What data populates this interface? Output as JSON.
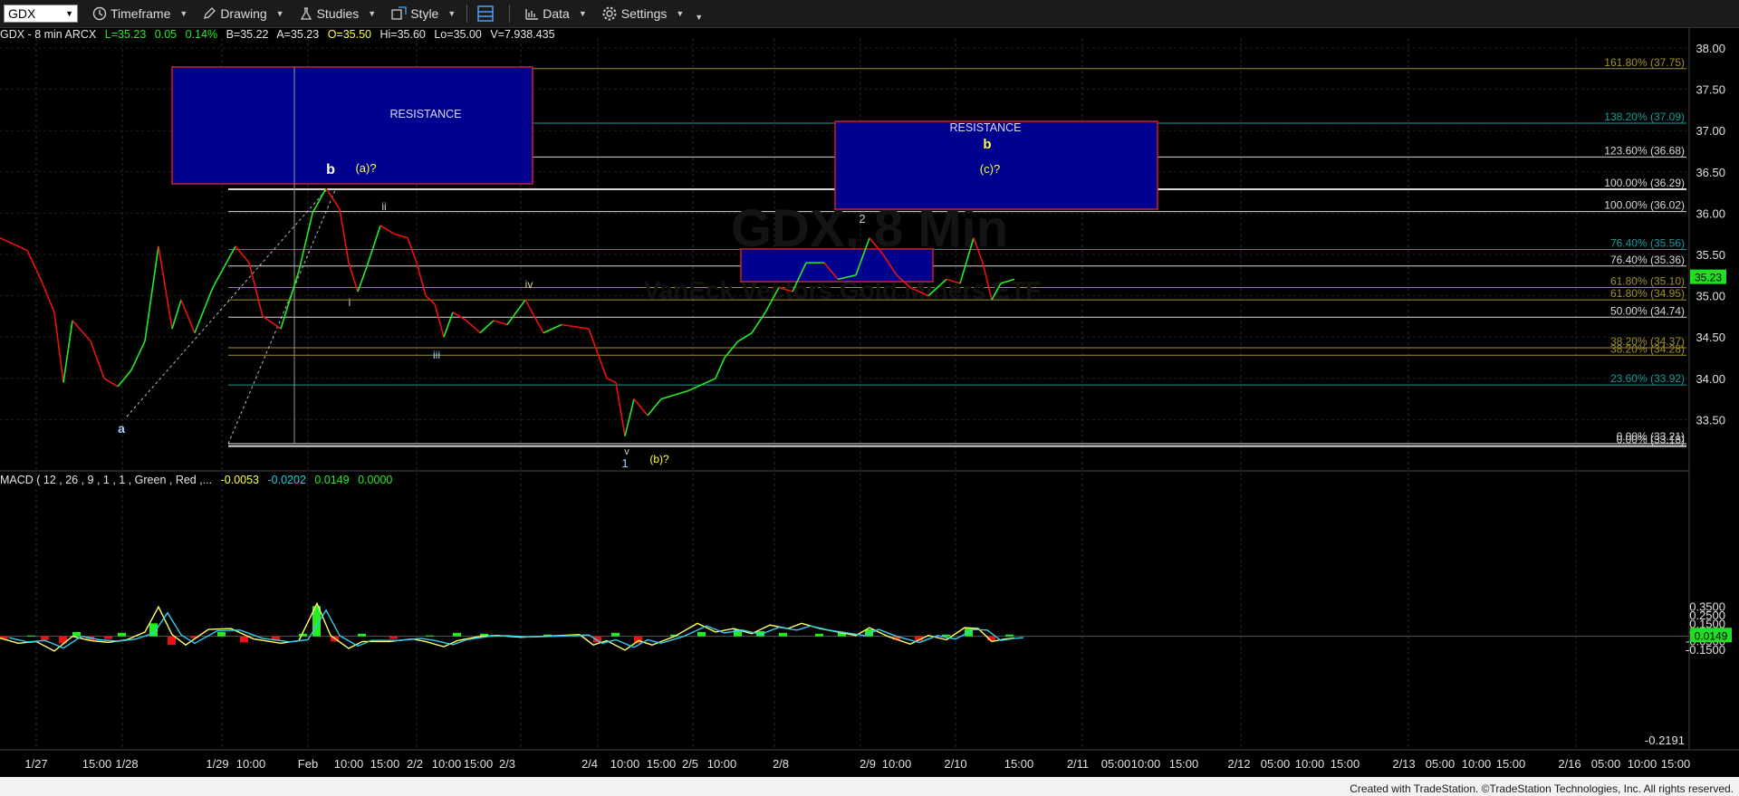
{
  "toolbar": {
    "symbol": "GDX",
    "timeframe": "Timeframe",
    "drawing": "Drawing",
    "studies": "Studies",
    "style": "Style",
    "data": "Data",
    "settings": "Settings"
  },
  "info": {
    "title": "GDX - 8 min  ARCX",
    "last": "L=35.23",
    "change": "0.05",
    "pct": "0.14%",
    "bid": "B=35.22",
    "ask": "A=35.23",
    "open": "O=35.50",
    "high": "Hi=35.60",
    "low": "Lo=35.00",
    "volume": "V=7,938,435"
  },
  "watermark": {
    "line1": "GDX, 8 Min",
    "line2": "VanEck Vectors Gold Miners ETF"
  },
  "macd": {
    "label": "MACD ( 12 , 26 , 9 , 1 , 1 , Green , Red ,...",
    "v1": "-0.0053",
    "v2": "-0.0202",
    "v3": "0.0149",
    "v4": "0.0000",
    "current": "0.0149",
    "min_label": "-0.2191",
    "ticks": [
      "0.3500",
      "0.2500",
      "0.1500",
      "0.0500",
      "-0.0500",
      "-0.1500"
    ]
  },
  "price_axis": {
    "ticks": [
      "38.00",
      "37.50",
      "37.00",
      "36.50",
      "36.00",
      "35.50",
      "35.00",
      "34.50",
      "34.00",
      "33.50"
    ],
    "current": "35.23"
  },
  "fib_levels": [
    {
      "label": "161.80% (37.75)",
      "price": 37.75,
      "color": "#a0902a"
    },
    {
      "label": "138.20% (37.09)",
      "price": 37.09,
      "color": "#1a9a9a"
    },
    {
      "label": "123.60% (36.68)",
      "price": 36.68,
      "color": "#d8d8d8"
    },
    {
      "label": "100.00% (36.29)",
      "price": 36.29,
      "color": "#d8d8d8"
    },
    {
      "label": "100.00% (36.02)",
      "price": 36.02,
      "color": "#d8d8d8"
    },
    {
      "label": "76.40% (35.56)",
      "price": 35.56,
      "color": "#1a9a9a"
    },
    {
      "label": "76.40% (35.36)",
      "price": 35.36,
      "color": "#d8d8d8"
    },
    {
      "label": "61.80% (35.10)",
      "price": 35.1,
      "color": "#a0902a"
    },
    {
      "label": "61.80% (34.95)",
      "price": 34.95,
      "color": "#a0902a"
    },
    {
      "label": "50.00% (34.74)",
      "price": 34.74,
      "color": "#d8d8d8"
    },
    {
      "label": "38.20% (34.37)",
      "price": 34.37,
      "color": "#a0902a"
    },
    {
      "label": "38.20% (34.28)",
      "price": 34.28,
      "color": "#a0902a"
    },
    {
      "label": "23.60% (33.92)",
      "price": 33.92,
      "color": "#1a9a9a"
    },
    {
      "label": "0.00% (33.21)",
      "price": 33.21,
      "color": "#d8d8d8"
    },
    {
      "label": "0.00% (33.18)",
      "price": 33.18,
      "color": "#d8d8d8"
    }
  ],
  "resistance": [
    {
      "label": "RESISTANCE"
    },
    {
      "label": "RESISTANCE"
    }
  ],
  "annotations": [
    {
      "text": "a",
      "color": "#9fd0ff"
    },
    {
      "text": "b",
      "color": "#ffffff"
    },
    {
      "text": "(a)?",
      "color": "#ffff44"
    },
    {
      "text": "i",
      "color": "#cccccc"
    },
    {
      "text": "ii",
      "color": "#cccccc"
    },
    {
      "text": "iii",
      "color": "#9fd0ff"
    },
    {
      "text": "iv",
      "color": "#cccccc"
    },
    {
      "text": "v",
      "color": "#cccccc"
    },
    {
      "text": "1",
      "color": "#9fd0ff"
    },
    {
      "text": "(b)?",
      "color": "#ffff44"
    },
    {
      "text": "2",
      "color": "#cccccc"
    },
    {
      "text": "b",
      "color": "#ffff44"
    },
    {
      "text": "(c)?",
      "color": "#ffff44"
    }
  ],
  "time_axis": [
    "1/27",
    "15:00",
    "1/28",
    "1/29",
    "10:00",
    "Feb",
    "10:00",
    "15:00",
    "2/2",
    "10:00",
    "15:00",
    "2/3",
    "2/4",
    "10:00",
    "15:00",
    "2/5",
    "10:00",
    "2/8",
    "2/9",
    "10:00",
    "2/10",
    "15:00",
    "2/11",
    "05:00",
    "10:00",
    "15:00",
    "2/12",
    "05:00",
    "10:00",
    "15:00",
    "2/13",
    "05:00",
    "10:00",
    "15:00",
    "2/16",
    "05:00",
    "10:00",
    "15:00"
  ],
  "footer": "Created with TradeStation. ©TradeStation Technologies, Inc. All rights reserved.",
  "colors": {
    "up": "#22ee22",
    "down": "#ee1111",
    "resistance_fill": "#00008f",
    "resistance_border": "#cc2222"
  }
}
